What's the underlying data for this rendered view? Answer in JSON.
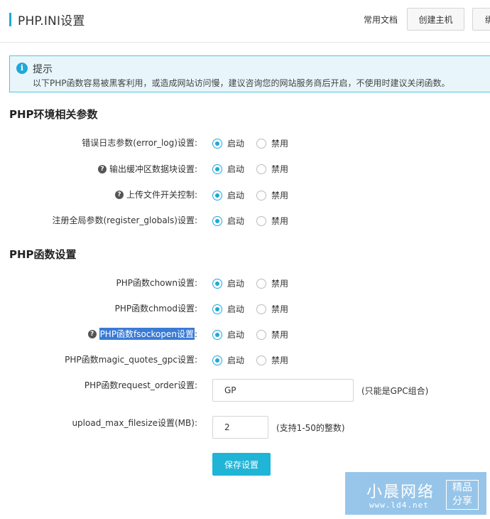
{
  "header": {
    "title": "PHP.INI设置",
    "doc_link": "常用文档",
    "create_button": "创建主机",
    "more_button": "绑"
  },
  "tip": {
    "icon": "i",
    "title": "提示",
    "text": "以下PHP函数容易被黑客利用，或造成网站访问慢，建议咨询您的网站服务商后开启，不使用时建议关闭函数。"
  },
  "radio_labels": {
    "enable": "启动",
    "disable": "禁用"
  },
  "sections": {
    "env_title": "PHP环境相关参数",
    "func_title": "PHP函数设置"
  },
  "env_params": [
    {
      "label": "错误日志参数(error_log)设置:",
      "value": "启动"
    },
    {
      "label": "输出缓冲区数据块设置:",
      "value": "启动"
    },
    {
      "label": "上传文件开关控制:",
      "value": "启动"
    },
    {
      "label": "注册全局参数(register_globals)设置:",
      "value": "启动"
    }
  ],
  "func_params": [
    {
      "label": "PHP函数chown设置:",
      "value": "启动"
    },
    {
      "label": "PHP函数chmod设置:",
      "value": "启动"
    },
    {
      "label": "PHP函数fsockopen设置",
      "label_suffix": ":",
      "value": "启动"
    },
    {
      "label": "PHP函数magic_quotes_gpc设置:",
      "value": "启动"
    }
  ],
  "request_order": {
    "label": "PHP函数request_order设置:",
    "value": "GP",
    "hint": "(只能是GPC组合)"
  },
  "upload_max": {
    "label": "upload_max_filesize设置(MB):",
    "value": "2",
    "hint": "(支持1-50的整数)"
  },
  "save_button": "保存设置",
  "watermark": {
    "main": "小晨网络",
    "url": "www.ld4.net",
    "badge_line1": "精品",
    "badge_line2": "分享"
  },
  "colors": {
    "accent": "#20a8d8",
    "save_button": "#20b4d6",
    "tip_background": "#e8f6fc",
    "selection_highlight": "#3a7bd5"
  }
}
